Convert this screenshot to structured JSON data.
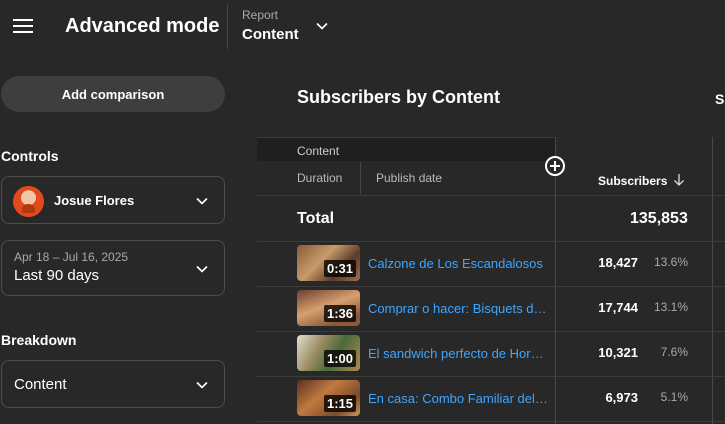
{
  "header": {
    "app_title": "Advanced mode",
    "report_label": "Report",
    "report_value": "Content"
  },
  "sidebar": {
    "add_comparison": "Add comparison",
    "controls_title": "Controls",
    "channel_name": "Josue Flores",
    "date_range": "Apr 18 – Jul 16, 2025",
    "date_label": "Last 90 days",
    "breakdown_title": "Breakdown",
    "breakdown_value": "Content"
  },
  "main": {
    "title": "Subscribers by Content",
    "cut_text": "Sl",
    "columns": {
      "content": "Content",
      "duration": "Duration",
      "publish_date": "Publish date",
      "subscribers": "Subscribers"
    },
    "total_label": "Total",
    "total_value": "135,853",
    "rows": [
      {
        "duration": "0:31",
        "title": "Calzone de Los Escandalosos",
        "subscribers": "18,427",
        "percent": "13.6%"
      },
      {
        "duration": "1:36",
        "title": "Comprar o hacer: Bisquets de Pan",
        "subscribers": "17,744",
        "percent": "13.1%"
      },
      {
        "duration": "1:00",
        "title": "El sandwich perfecto de Hora de Aventura",
        "subscribers": "10,321",
        "percent": "7.6%"
      },
      {
        "duration": "1:15",
        "title": "En casa: Combo Familiar del KFC",
        "subscribers": "6,973",
        "percent": "5.1%"
      }
    ]
  },
  "colors": {
    "background": "#282828",
    "link": "#3ea6ff"
  }
}
